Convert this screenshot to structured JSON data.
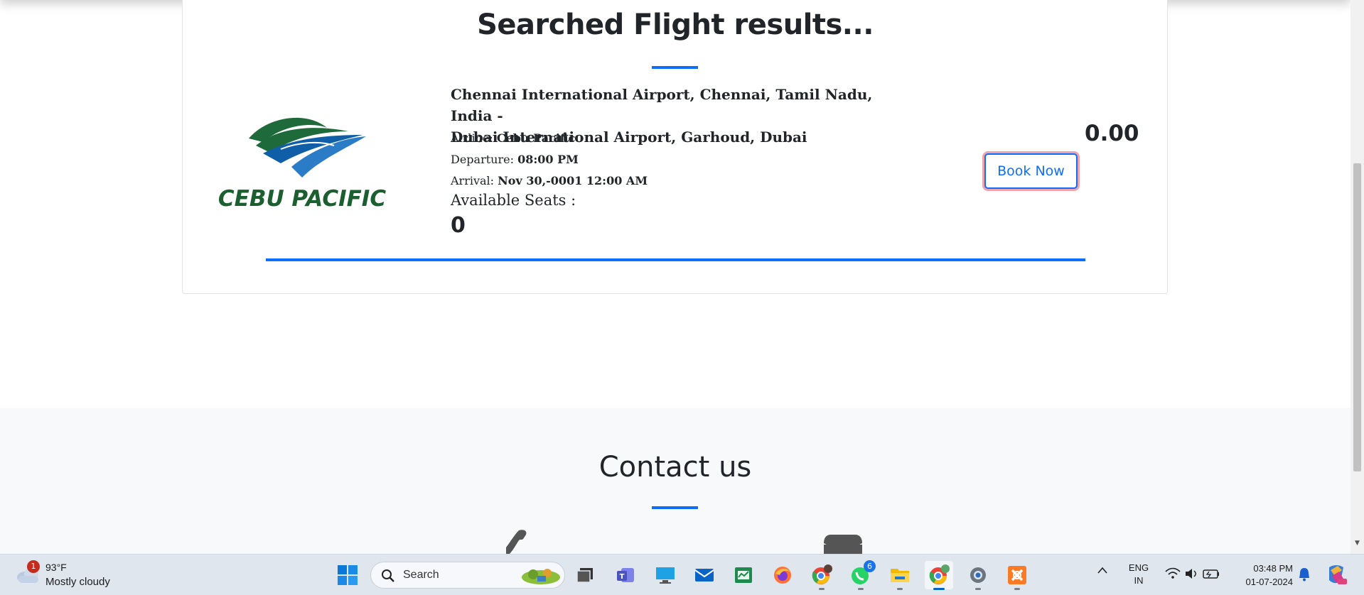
{
  "results": {
    "title": "Searched Flight results...",
    "flight": {
      "route_line1": "Chennai International Airport, Chennai, Tamil Nadu, India -",
      "route_line2": "Dubai International Airport, Garhoud, Dubai",
      "airline_label": "Airline:",
      "airline_value": "Cebu Pacific",
      "departure_label": "Departure:",
      "departure_value": "08:00 PM",
      "arrival_label": "Arrival:",
      "arrival_value": "Nov 30,-0001 12:00 AM",
      "seats_label": "Available Seats :",
      "seats_value": "0",
      "price": "0.00",
      "book_label": "Book Now",
      "logo_text": "CEBU PACIFIC"
    }
  },
  "contact": {
    "title": "Contact us",
    "icons": [
      "phone-icon",
      "mail-icon"
    ]
  },
  "taskbar": {
    "weather": {
      "badge": "1",
      "temperature": "93°F",
      "description": "Mostly cloudy"
    },
    "search_placeholder": "Search",
    "apps": [
      {
        "name": "windows-start-icon"
      },
      {
        "name": "task-view-icon"
      },
      {
        "name": "teams-icon"
      },
      {
        "name": "remote-desktop-icon"
      },
      {
        "name": "mail-app-icon"
      },
      {
        "name": "sheets-app-icon"
      },
      {
        "name": "firefox-icon"
      },
      {
        "name": "chrome-profile-icon"
      },
      {
        "name": "whatsapp-icon",
        "badge": "6"
      },
      {
        "name": "file-explorer-icon"
      },
      {
        "name": "chrome-active-icon"
      },
      {
        "name": "settings-icon"
      },
      {
        "name": "xampp-icon"
      }
    ],
    "language_line1": "ENG",
    "language_line2": "IN",
    "time": "03:48 PM",
    "date": "01-07-2024"
  },
  "colors": {
    "accent": "#0d6efd",
    "text": "#212529",
    "contact_bg": "#f8f9fa",
    "taskbar_bg": "#dfe6ee"
  }
}
